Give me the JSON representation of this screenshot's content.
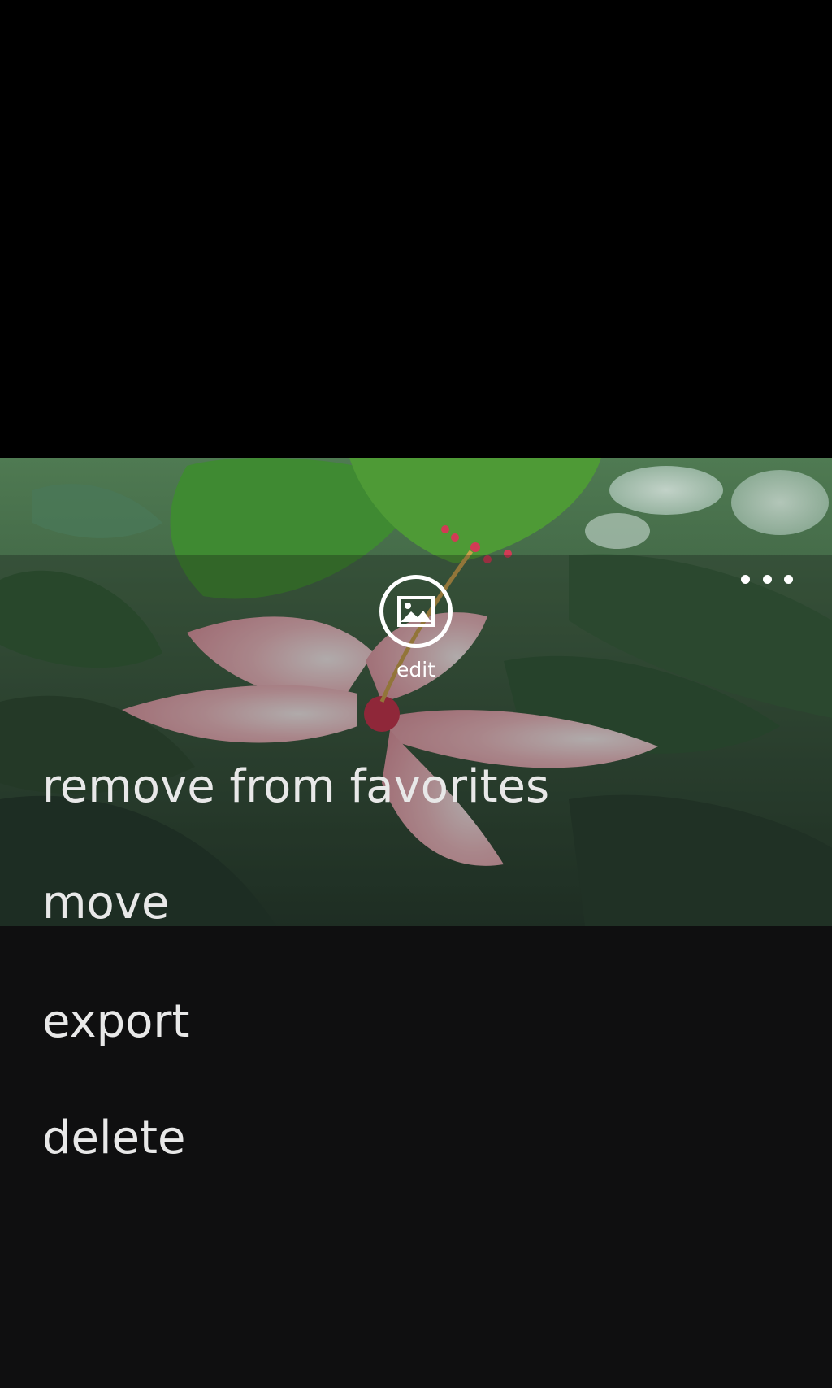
{
  "app_bar": {
    "edit_label": "edit",
    "edit_icon": "picture-edit-icon",
    "more_icon": "ellipsis-icon"
  },
  "menu": {
    "items": [
      {
        "label": "remove from favorites"
      },
      {
        "label": "move"
      },
      {
        "label": "export"
      },
      {
        "label": "delete"
      }
    ]
  },
  "colors": {
    "background": "#000000",
    "menu_panel": "#0f0f10",
    "menu_text": "#e8e8e8",
    "icon": "#ffffff"
  }
}
